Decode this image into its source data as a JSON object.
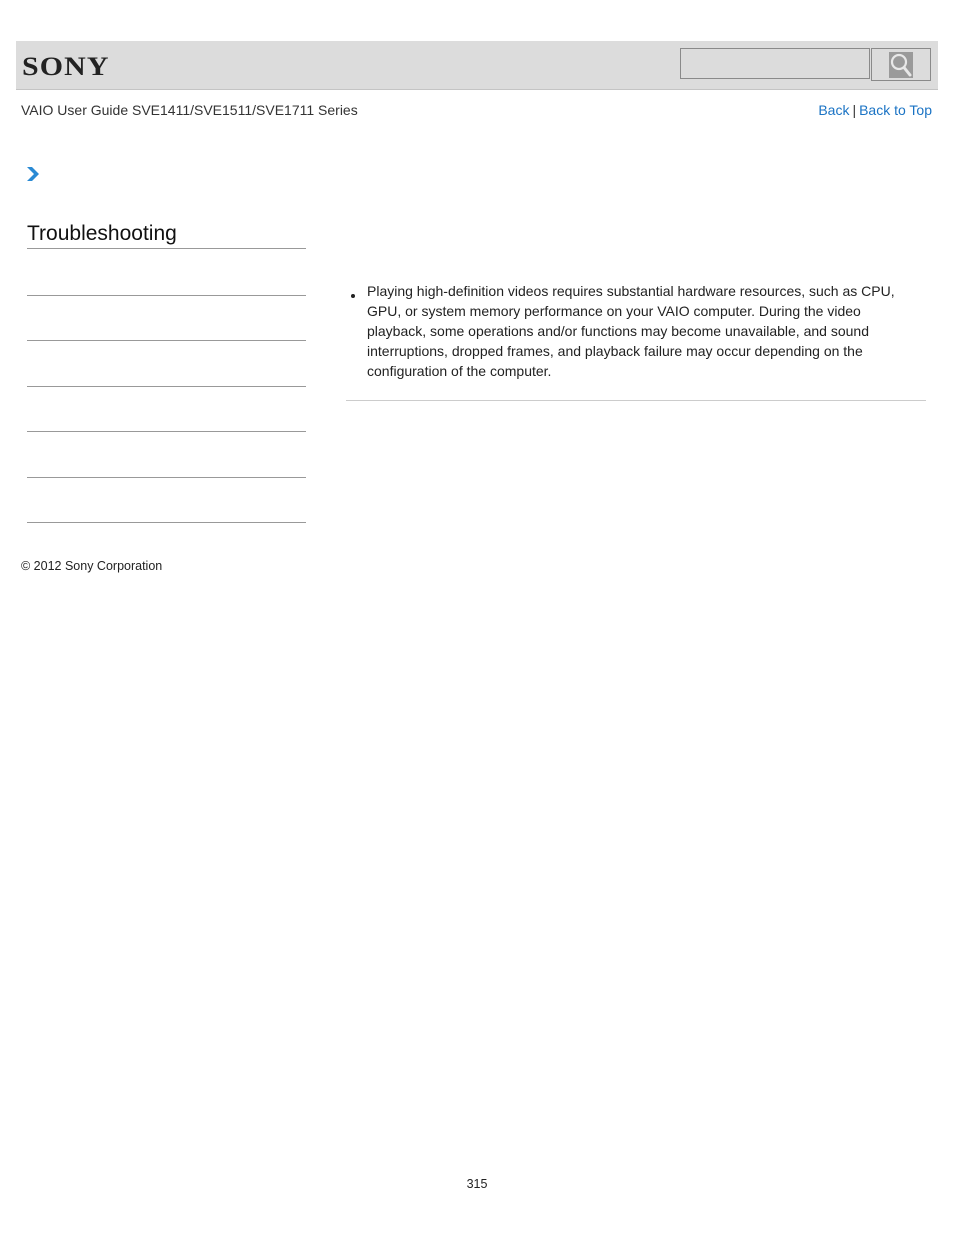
{
  "header": {
    "logo_text": "SONY",
    "search": {
      "placeholder": "",
      "value": "",
      "button_icon": "search-icon"
    }
  },
  "subheader": {
    "guide_title": "VAIO User Guide SVE1411/SVE1511/SVE1711 Series",
    "links": {
      "back": "Back",
      "separator": "|",
      "back_to_top": "Back to Top"
    }
  },
  "breadcrumb": {
    "icon": "chevron-right-icon"
  },
  "sidebar": {
    "section_title": "Troubleshooting",
    "items": [
      "",
      "",
      "",
      "",
      "",
      ""
    ]
  },
  "main": {
    "bullets": [
      "Playing high-definition videos requires substantial hardware resources, such as CPU, GPU, or system memory performance on your VAIO computer. During the video playback, some operations and/or functions may become unavailable, and sound interruptions, dropped frames, and playback failure may occur depending on the configuration of the computer."
    ]
  },
  "footer": {
    "copyright": "© 2012 Sony Corporation",
    "page_number": "315"
  },
  "colors": {
    "link": "#1a73c4",
    "header_bg": "#dcdcdc",
    "accent_arrow": "#2a8ad4"
  }
}
